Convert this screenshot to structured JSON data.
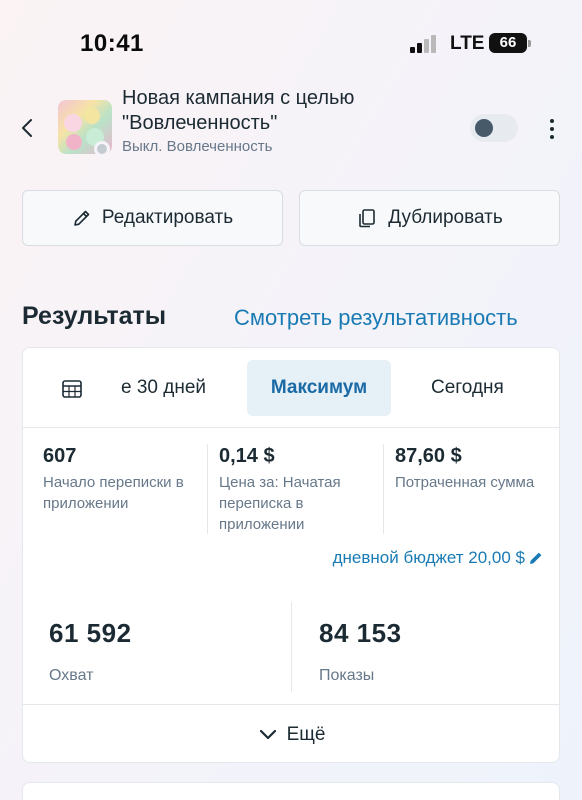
{
  "status_bar": {
    "time": "10:41",
    "network": "LTE",
    "battery": "66"
  },
  "campaign": {
    "title": "Новая кампания с целью \"Вовлеченность\"",
    "status_line": "Выкл. Вовлеченность",
    "toggle_on": false
  },
  "actions": {
    "edit_label": "Редактировать",
    "duplicate_label": "Дублировать"
  },
  "results": {
    "title": "Результаты",
    "view_performance_link": "Смотреть результативность",
    "tabs": [
      {
        "label": "е 30 дней",
        "selected": false
      },
      {
        "label": "Максимум",
        "selected": true
      },
      {
        "label": "Сегодня",
        "selected": false
      }
    ],
    "metrics": [
      {
        "value": "607",
        "label": "Начало переписки в приложении"
      },
      {
        "value": "0,14 $",
        "label": "Цена за: Начатая переписка в приложении"
      },
      {
        "value": "87,60 $",
        "label": "Потраченная сумма"
      }
    ],
    "daily_budget": "дневной бюджет 20,00 $",
    "reach": {
      "value": "61 592",
      "label": "Охват"
    },
    "impressions": {
      "value": "84 153",
      "label": "Показы"
    },
    "more_label": "Ещё"
  },
  "colors": {
    "accent": "#1a7bb4",
    "selected_tab_bg": "#e6f0f7",
    "text": "#1c2b33",
    "muted": "#67788a"
  }
}
